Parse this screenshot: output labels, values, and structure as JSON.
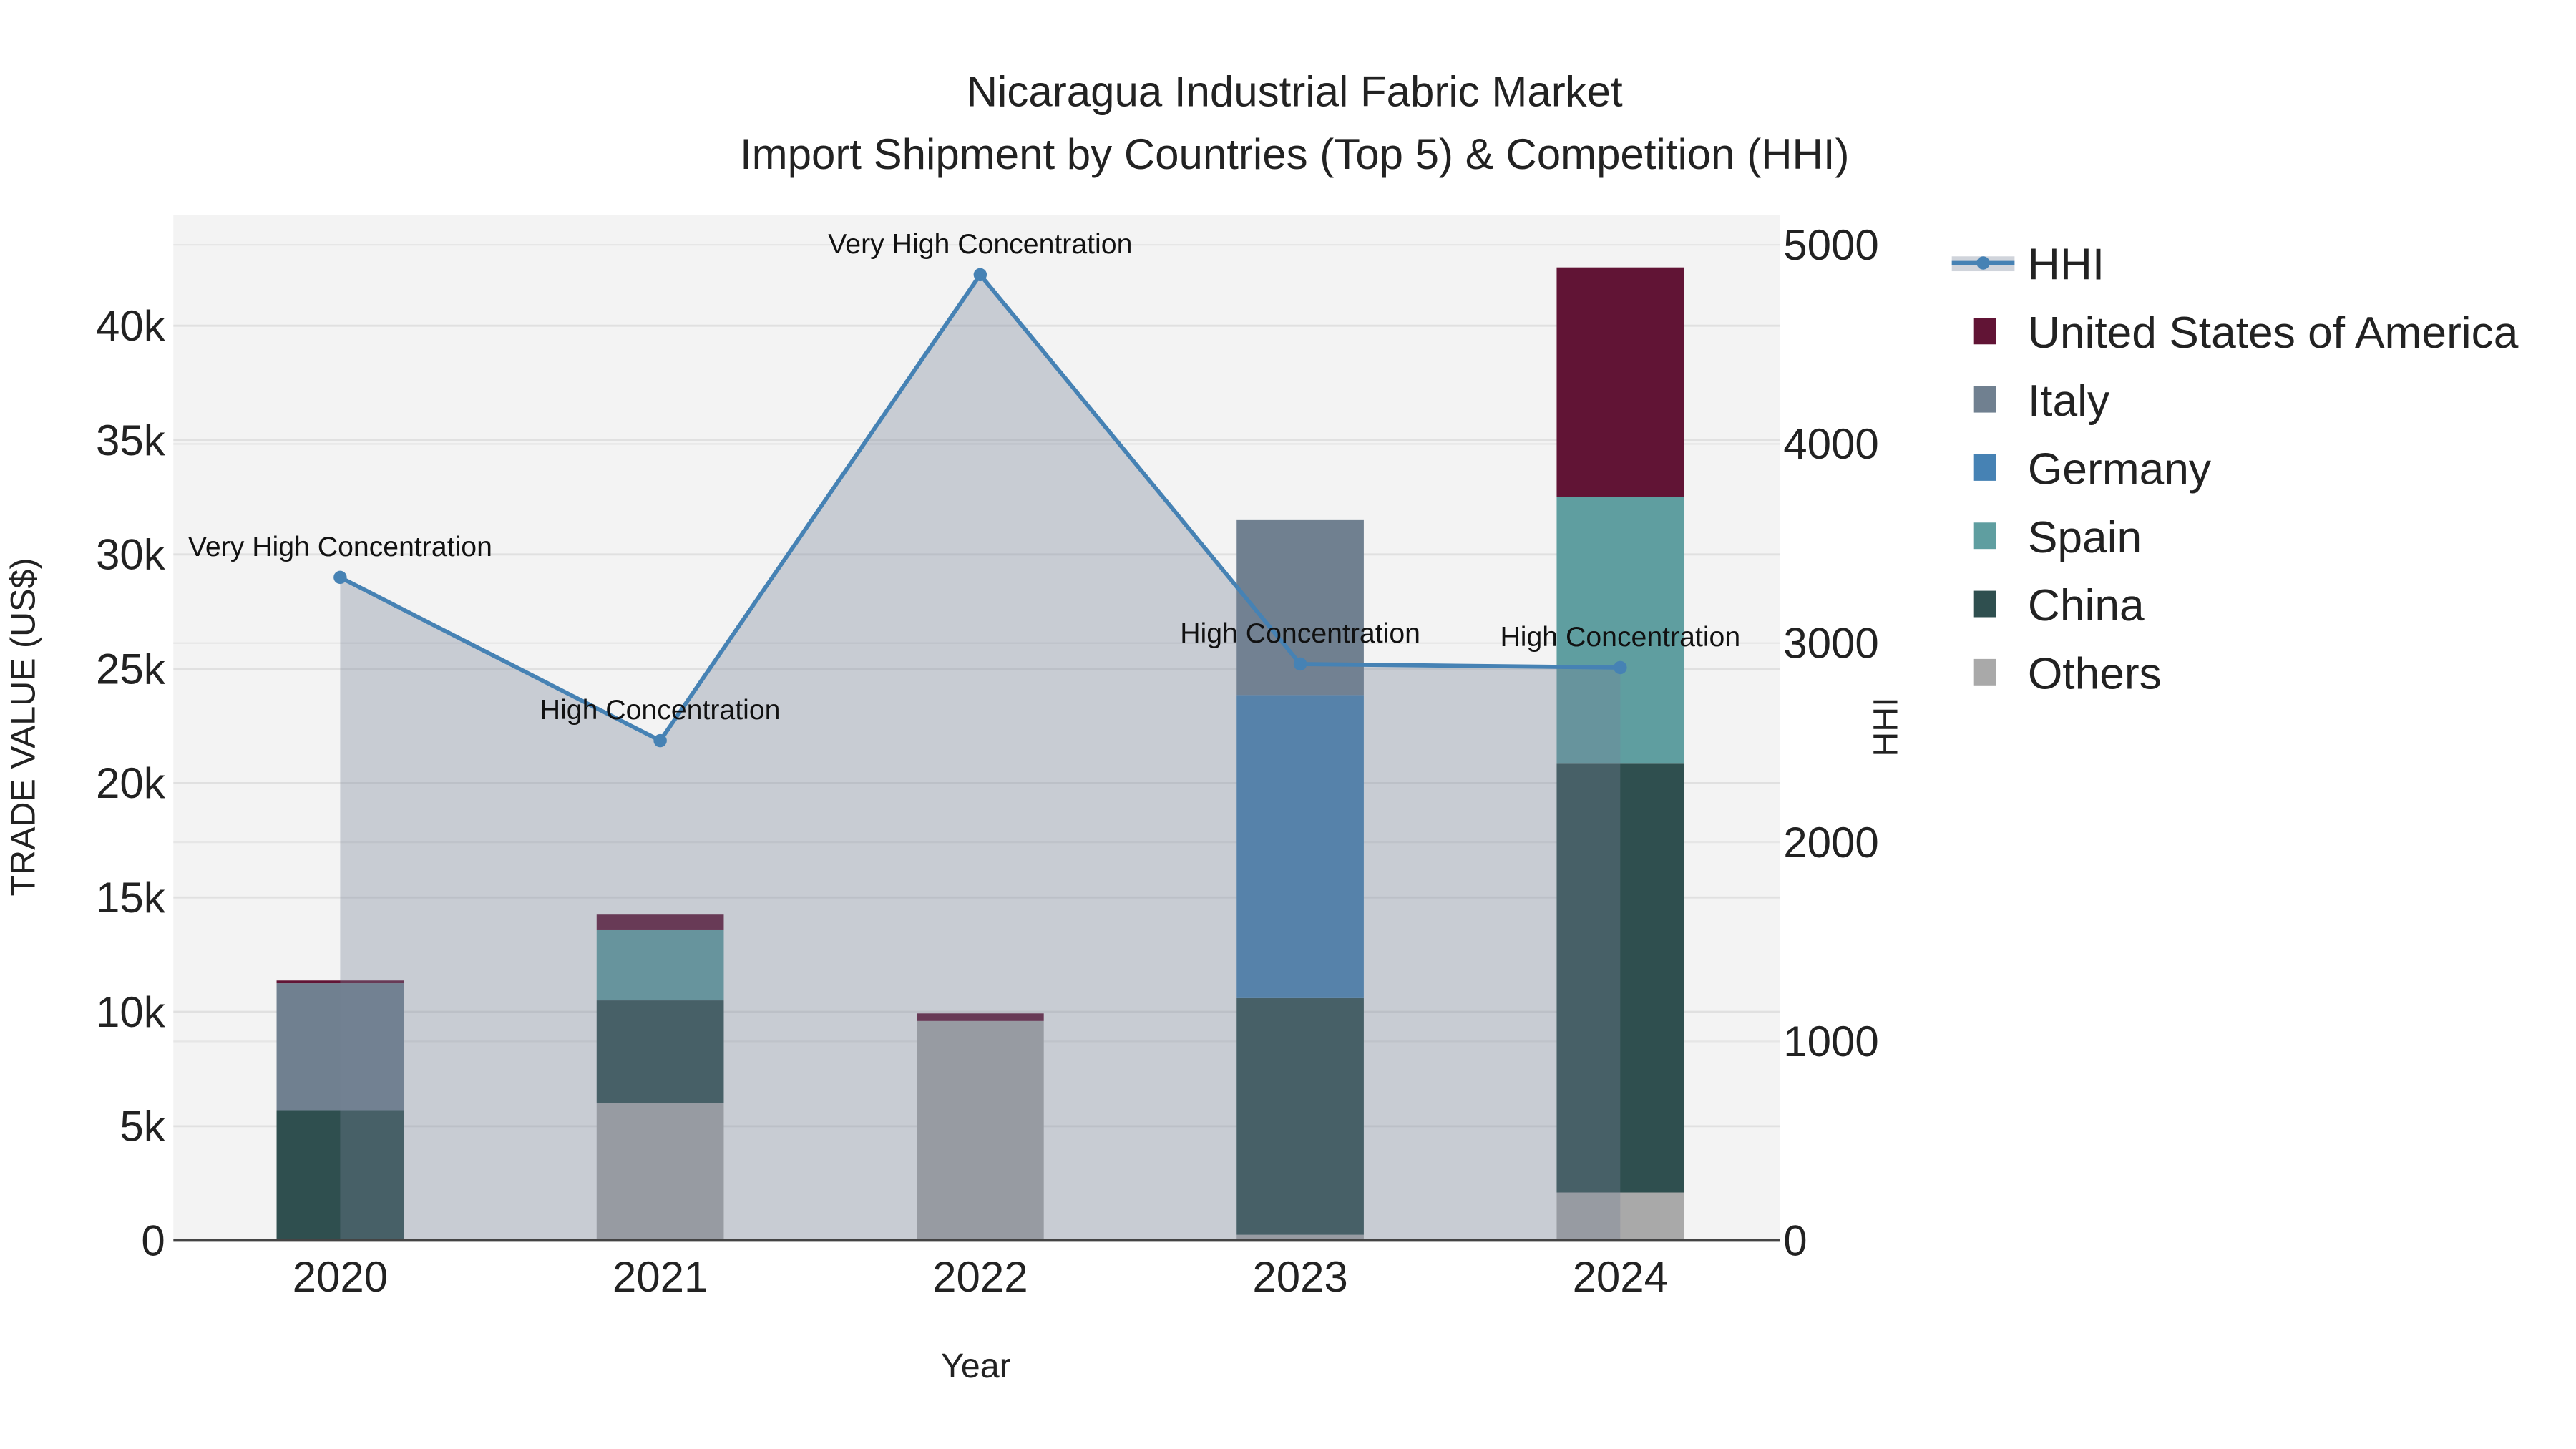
{
  "chart_data": {
    "type": "bar",
    "title": [
      "Nicaragua Industrial Fabric Market",
      "Import Shipment by Countries (Top 5) & Competition (HHI)"
    ],
    "xlabel": "Year",
    "ylabel": "TRADE VALUE (US$)",
    "y2label": "HHI",
    "categories": [
      "2020",
      "2021",
      "2022",
      "2023",
      "2024"
    ],
    "ylim": [
      0,
      45000
    ],
    "y_ticks": [
      0,
      5000,
      10000,
      15000,
      20000,
      25000,
      30000,
      35000,
      40000
    ],
    "y_tick_labels": [
      "0",
      "5k",
      "10k",
      "15k",
      "20k",
      "25k",
      "30k",
      "35k",
      "40k"
    ],
    "y2lim": [
      0,
      5150
    ],
    "y2_ticks": [
      0,
      1000,
      2000,
      3000,
      4000,
      5000
    ],
    "y2_tick_labels": [
      "0",
      "1000",
      "2000",
      "3000",
      "4000",
      "5000"
    ],
    "stacked": true,
    "series": [
      {
        "name": "Others",
        "color": "#a9a9a9",
        "values": [
          0,
          6000,
          9600,
          250,
          2100
        ]
      },
      {
        "name": "China",
        "color": "#2f4f4f",
        "values": [
          5700,
          4500,
          0,
          10350,
          18750
        ]
      },
      {
        "name": "Spain",
        "color": "#5f9ea0",
        "values": [
          0,
          3100,
          0,
          0,
          11650
        ]
      },
      {
        "name": "Germany",
        "color": "#4682b4",
        "values": [
          0,
          0,
          0,
          13250,
          0
        ]
      },
      {
        "name": "Italy",
        "color": "#708090",
        "values": [
          5550,
          0,
          0,
          7650,
          0
        ]
      },
      {
        "name": "United States of America",
        "color": "#611435",
        "values": [
          120,
          650,
          330,
          0,
          10050
        ]
      }
    ],
    "line_series": {
      "name": "HHI",
      "color": "#4682b4",
      "axis": "right",
      "values": [
        3330,
        2510,
        4850,
        2895,
        2877
      ],
      "annotations": [
        "Very High Concentration",
        "High Concentration",
        "Very High Concentration",
        "High Concentration",
        "High Concentration"
      ]
    },
    "legend": {
      "placement": "right",
      "entries": [
        "HHI",
        "United States of America",
        "Italy",
        "Germany",
        "Spain",
        "China",
        "Others"
      ]
    },
    "grid": true
  }
}
